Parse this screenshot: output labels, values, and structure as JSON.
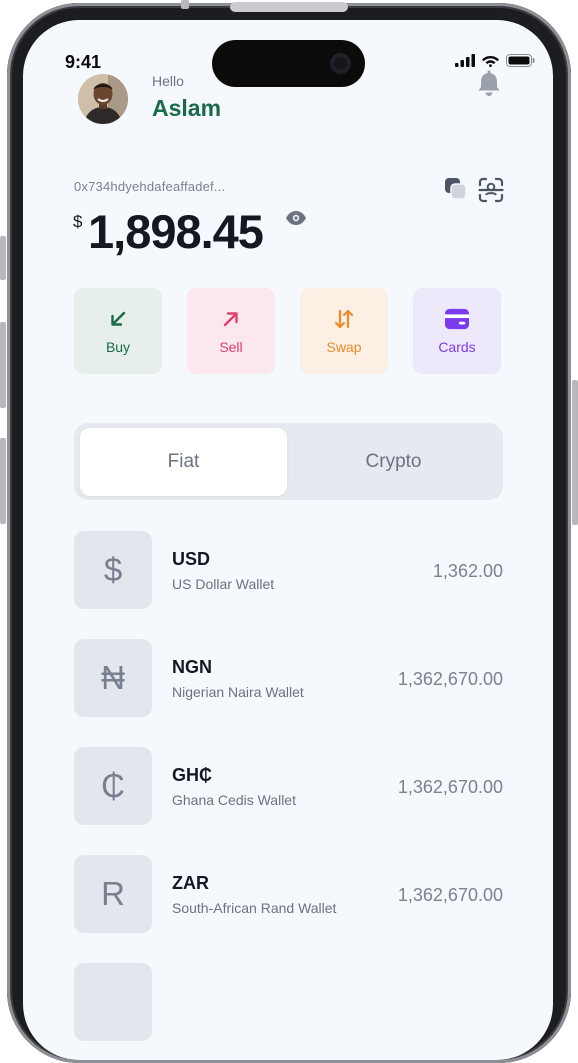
{
  "status_bar": {
    "time": "9:41"
  },
  "header": {
    "greeting": "Hello",
    "username": "Aslam"
  },
  "wallet_summary": {
    "address": "0x734hdyehdafeaffadef...",
    "currency_symbol": "$",
    "balance": "1,898.45"
  },
  "actions": [
    {
      "label": "Buy",
      "icon": "arrow-down-left-icon",
      "bg": "#e6efeb",
      "color": "#1a6b48"
    },
    {
      "label": "Sell",
      "icon": "arrow-up-right-icon",
      "bg": "#fbe8ee",
      "color": "#e0406a"
    },
    {
      "label": "Swap",
      "icon": "swap-icon",
      "bg": "#fcefe4",
      "color": "#f08a2c"
    },
    {
      "label": "Cards",
      "icon": "card-icon",
      "bg": "#eee8fb",
      "color": "#7c3aed"
    }
  ],
  "tabs": {
    "active": "Fiat",
    "inactive": "Crypto"
  },
  "wallets": [
    {
      "symbol": "$",
      "code": "USD",
      "name": "US Dollar Wallet",
      "amount": "1,362.00"
    },
    {
      "symbol": "₦",
      "code": "NGN",
      "name": "Nigerian Naira Wallet",
      "amount": "1,362,670.00"
    },
    {
      "symbol": "₵",
      "code": "GH₵",
      "name": "Ghana Cedis Wallet",
      "amount": "1,362,670.00"
    },
    {
      "symbol": "R",
      "code": "ZAR",
      "name": "South-African Rand Wallet",
      "amount": "1,362,670.00"
    }
  ]
}
